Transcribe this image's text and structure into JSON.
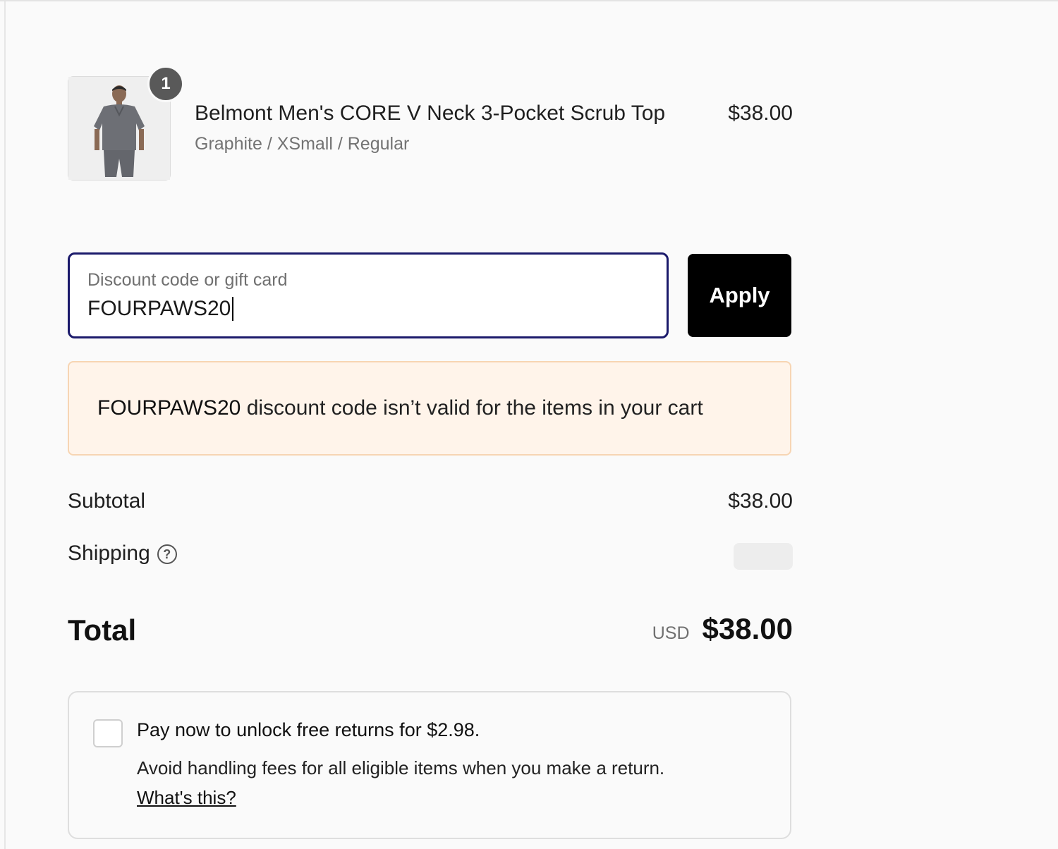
{
  "product": {
    "quantity": "1",
    "name": "Belmont Men's CORE V Neck 3-Pocket Scrub Top",
    "variant": "Graphite / XSmall / Regular",
    "price": "$38.00"
  },
  "discount": {
    "label": "Discount code or gift card",
    "value": "FOURPAWS20",
    "apply_label": "Apply",
    "error_code": "FOURPAWS20",
    "error_message": " discount code isn’t valid for the items in your cart"
  },
  "totals": {
    "subtotal_label": "Subtotal",
    "subtotal_value": "$38.00",
    "shipping_label": "Shipping",
    "total_label": "Total",
    "currency": "USD",
    "total_value": "$38.00"
  },
  "returns": {
    "title": "Pay now to unlock free returns for $2.98.",
    "description": "Avoid handling fees for all eligible items when you make a return.",
    "link": "What's this?"
  },
  "colors": {
    "focus_border": "#1b1a6b",
    "error_bg": "#fff4ea",
    "error_border": "#f7d5b3",
    "button_bg": "#000000"
  }
}
